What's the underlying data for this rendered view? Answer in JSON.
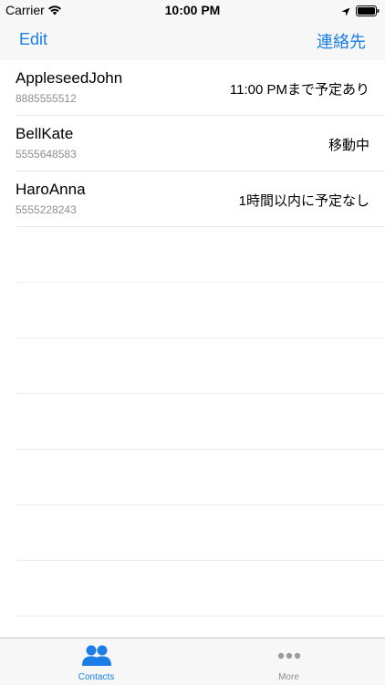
{
  "status_bar": {
    "carrier": "Carrier",
    "time": "10:00 PM"
  },
  "nav_bar": {
    "left_button": "Edit",
    "right_button": "連絡先"
  },
  "contacts": [
    {
      "name": "AppleseedJohn",
      "phone": "8885555512",
      "status": "11:00 PMまで予定あり"
    },
    {
      "name": "BellKate",
      "phone": "5555648583",
      "status": "移動中"
    },
    {
      "name": "HaroAnna",
      "phone": "5555228243",
      "status": "1時間以内に予定なし"
    }
  ],
  "tab_bar": {
    "tabs": [
      {
        "label": "Contacts",
        "icon": "contacts-icon",
        "selected": true
      },
      {
        "label": "More",
        "icon": "more-icon",
        "selected": false
      }
    ]
  },
  "colors": {
    "accent": "#1a7ee6",
    "secondary_text": "#8e8e93",
    "bar_background": "#f7f7f7"
  }
}
